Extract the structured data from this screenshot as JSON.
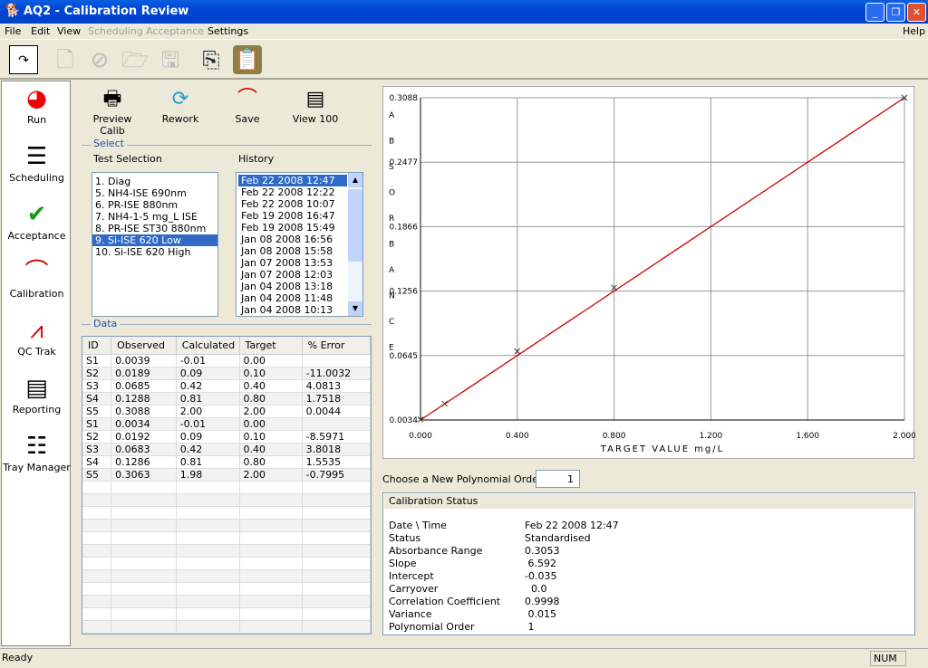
{
  "window": {
    "title": "AQ2 - Calibration Review",
    "app_icon": "dog-head-icon",
    "controls": [
      "_",
      "❐",
      "✕"
    ]
  },
  "menu": [
    {
      "label": "File",
      "enabled": true
    },
    {
      "label": "Edit",
      "enabled": true
    },
    {
      "label": "View",
      "enabled": true
    },
    {
      "label": "Scheduling",
      "enabled": false
    },
    {
      "label": "Acceptance",
      "enabled": false
    },
    {
      "label": "Settings",
      "enabled": true
    }
  ],
  "menu_help": "Help",
  "toolbar": [
    "calendar-icon",
    "new-document-icon",
    "cancel-icon",
    "open-folder-icon",
    "save-disk-icon",
    "copy-icon",
    "paste-icon"
  ],
  "sidebar": {
    "items": [
      {
        "label": "Run",
        "icon": "pie-chart-icon"
      },
      {
        "label": "Scheduling",
        "icon": "list-icon"
      },
      {
        "label": "Acceptance",
        "icon": "checkmark-icon"
      },
      {
        "label": "Calibration",
        "icon": "curve-icon"
      },
      {
        "label": "QC Trak",
        "icon": "qc-chart-icon"
      },
      {
        "label": "Reporting",
        "icon": "report-icon"
      },
      {
        "label": "Tray Manager",
        "icon": "tray-icon"
      }
    ]
  },
  "actions": [
    {
      "label": "Preview Calib",
      "icon": "printer-icon"
    },
    {
      "label": "Rework",
      "icon": "refresh-icon"
    },
    {
      "label": "Save",
      "icon": "save-curve-icon"
    },
    {
      "label": "View 100",
      "icon": "view-list-icon"
    }
  ],
  "select": {
    "group_label": "Select",
    "test_label": "Test Selection",
    "history_label": "History",
    "tests": [
      "1. Diag",
      "5. NH4-ISE 690nm",
      "6. PR-ISE 880nm",
      "7. NH4-1-5 mg_L ISE",
      "8. PR-ISE ST30 880nm",
      "9. Si-ISE 620 Low",
      "10. Si-ISE 620 High"
    ],
    "selected_test": "9. Si-ISE 620 Low",
    "history": [
      "Feb 22 2008 12:47",
      "Feb 22 2008 12:22",
      "Feb 22 2008 10:07",
      "Feb 19 2008 16:47",
      "Feb 19 2008 15:49",
      "Jan 08 2008 16:56",
      "Jan 08 2008 15:58",
      "Jan 07 2008 13:53",
      "Jan 07 2008 12:03",
      "Jan 04 2008 13:18",
      "Jan 04 2008 11:48",
      "Jan 04 2008 10:13"
    ],
    "selected_history": "Feb 22 2008 12:47"
  },
  "data": {
    "group_label": "Data",
    "columns": [
      "ID",
      "Observed",
      "Calculated",
      "Target",
      "% Error"
    ],
    "rows": [
      [
        "S1",
        "0.0039",
        "-0.01",
        "0.00",
        ""
      ],
      [
        "S2",
        "0.0189",
        "0.09",
        "0.10",
        "-11.0032"
      ],
      [
        "S3",
        "0.0685",
        "0.42",
        "0.40",
        "4.0813"
      ],
      [
        "S4",
        "0.1288",
        "0.81",
        "0.80",
        "1.7518"
      ],
      [
        "S5",
        "0.3088",
        "2.00",
        "2.00",
        "0.0044"
      ],
      [
        "S1",
        "0.0034",
        "-0.01",
        "0.00",
        ""
      ],
      [
        "S2",
        "0.0192",
        "0.09",
        "0.10",
        "-8.5971"
      ],
      [
        "S3",
        "0.0683",
        "0.42",
        "0.40",
        "3.8018"
      ],
      [
        "S4",
        "0.1286",
        "0.81",
        "0.80",
        "1.5535"
      ],
      [
        "S5",
        "0.3063",
        "1.98",
        "2.00",
        "-0.7995"
      ]
    ]
  },
  "chart_data": {
    "type": "scatter",
    "xlabel": "TARGET VALUE mg/L",
    "ylabel": "ABSORBANCE",
    "xlim": [
      0,
      2
    ],
    "ylim": [
      0.0034,
      0.3088
    ],
    "xticks": [
      "0.000",
      "0.400",
      "0.800",
      "1.200",
      "1.600",
      "2.000"
    ],
    "yticks": [
      "0.0034",
      "0.0645",
      "0.1256",
      "0.1866",
      "0.2477",
      "0.3088"
    ],
    "grid": true,
    "points": {
      "x": [
        0,
        0.1,
        0.4,
        0.8,
        2.0
      ],
      "y": [
        0.0039,
        0.0189,
        0.0685,
        0.1288,
        0.3088
      ]
    },
    "fit_line": {
      "x": [
        0,
        2.0
      ],
      "y": [
        0.0034,
        0.3088
      ],
      "color": "#CC0000"
    }
  },
  "polynomial": {
    "label": "Choose a New Polynomial Order:",
    "value": "1"
  },
  "calibration_status": {
    "title": "Calibration Status",
    "rows": [
      [
        "Date \\ Time",
        "Feb 22 2008 12:47"
      ],
      [
        "Status",
        "Standardised"
      ],
      [
        "Absorbance Range",
        "0.3053"
      ],
      [
        "Slope",
        " 6.592"
      ],
      [
        "Intercept",
        "-0.035"
      ],
      [
        "Carryover",
        "  0.0"
      ],
      [
        "Correlation Coefficient",
        "0.9998"
      ],
      [
        "Variance",
        " 0.015"
      ],
      [
        "Polynomial Order",
        " 1"
      ]
    ]
  },
  "statusbar": {
    "text": "Ready",
    "num": "NUM"
  }
}
